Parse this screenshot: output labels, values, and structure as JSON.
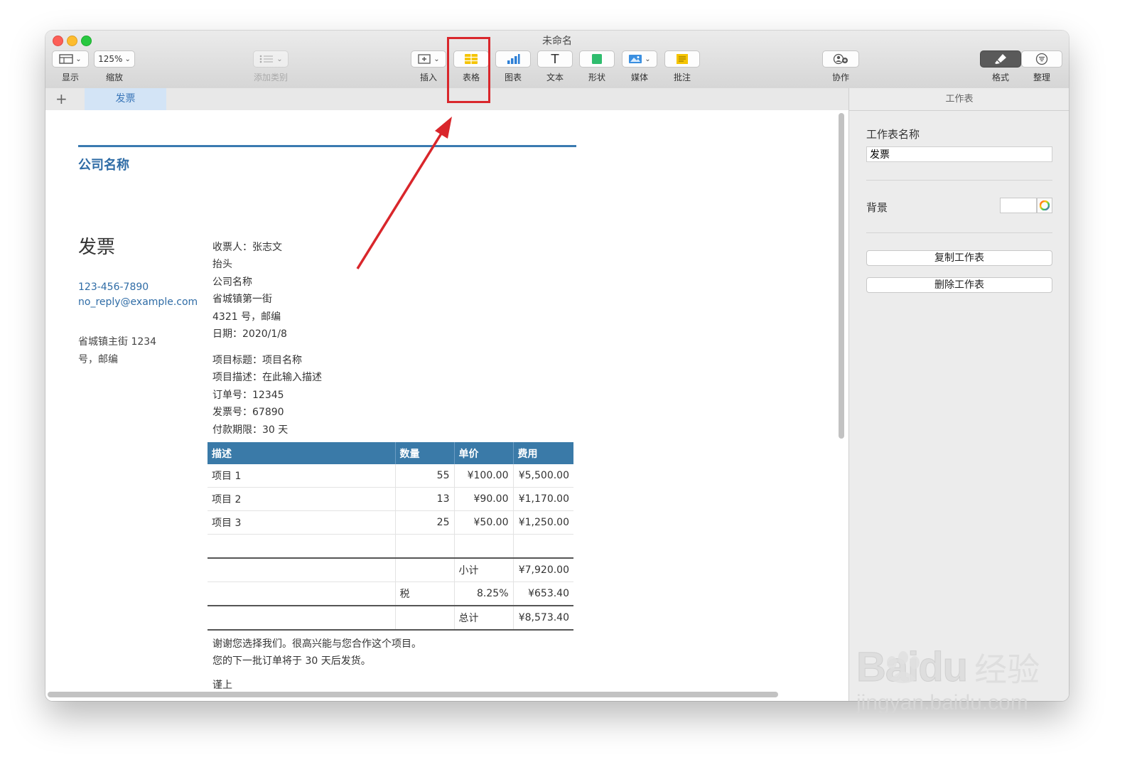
{
  "window": {
    "title": "未命名"
  },
  "toolbar": {
    "view": {
      "label": "显示"
    },
    "zoom": {
      "value": "125%",
      "label": "缩放"
    },
    "add_category": {
      "label": "添加类别"
    },
    "insert": {
      "label": "插入"
    },
    "table": {
      "label": "表格"
    },
    "chart": {
      "label": "图表"
    },
    "text": {
      "label": "文本",
      "glyph": "T"
    },
    "shape": {
      "label": "形状"
    },
    "media": {
      "label": "媒体"
    },
    "comment": {
      "label": "批注"
    },
    "collaborate": {
      "label": "协作"
    },
    "format": {
      "label": "格式"
    },
    "organize": {
      "label": "整理"
    }
  },
  "tabs": {
    "add": "+",
    "sheets": [
      {
        "label": "发票",
        "active": true
      }
    ]
  },
  "sidebar": {
    "header": "工作表",
    "name_label": "工作表名称",
    "name_value": "发票",
    "background_label": "背景",
    "duplicate_button": "复制工作表",
    "delete_button": "删除工作表"
  },
  "invoice": {
    "company": "公司名称",
    "title": "发票",
    "phone": "123-456-7890",
    "email": "no_reply@example.com",
    "address": [
      "省城镇主街 1234",
      "号，邮编"
    ],
    "recipient": [
      "收票人：张志文",
      "抬头",
      "公司名称",
      "省城镇第一街",
      "4321 号，邮编",
      "日期：2020/1/8"
    ],
    "project": [
      "项目标题：项目名称",
      "项目描述：在此输入描述",
      "订单号：12345",
      "发票号：67890",
      "付款期限：30 天"
    ],
    "table": {
      "headers": [
        "描述",
        "数量",
        "单价",
        "费用"
      ],
      "rows": [
        [
          "项目 1",
          "55",
          "¥100.00",
          "¥5,500.00"
        ],
        [
          "项目 2",
          "13",
          "¥90.00",
          "¥1,170.00"
        ],
        [
          "项目 3",
          "25",
          "¥50.00",
          "¥1,250.00"
        ]
      ],
      "subtotal_label": "小计",
      "subtotal_value": "¥7,920.00",
      "tax_label": "税",
      "tax_rate": "8.25%",
      "tax_value": "¥653.40",
      "total_label": "总计",
      "total_value": "¥8,573.40"
    },
    "thanks": [
      "谢谢您选择我们。很高兴能与您合作这个项目。",
      "您的下一批订单将于 30 天后发货。",
      "谨上"
    ]
  },
  "watermark": {
    "brand": "Baidu",
    "product": "经验",
    "url": "jingyan.baidu.com"
  },
  "colors": {
    "accent": "#2f6ca6",
    "table_header": "#3a7aa8",
    "highlight": "#d9262b"
  }
}
